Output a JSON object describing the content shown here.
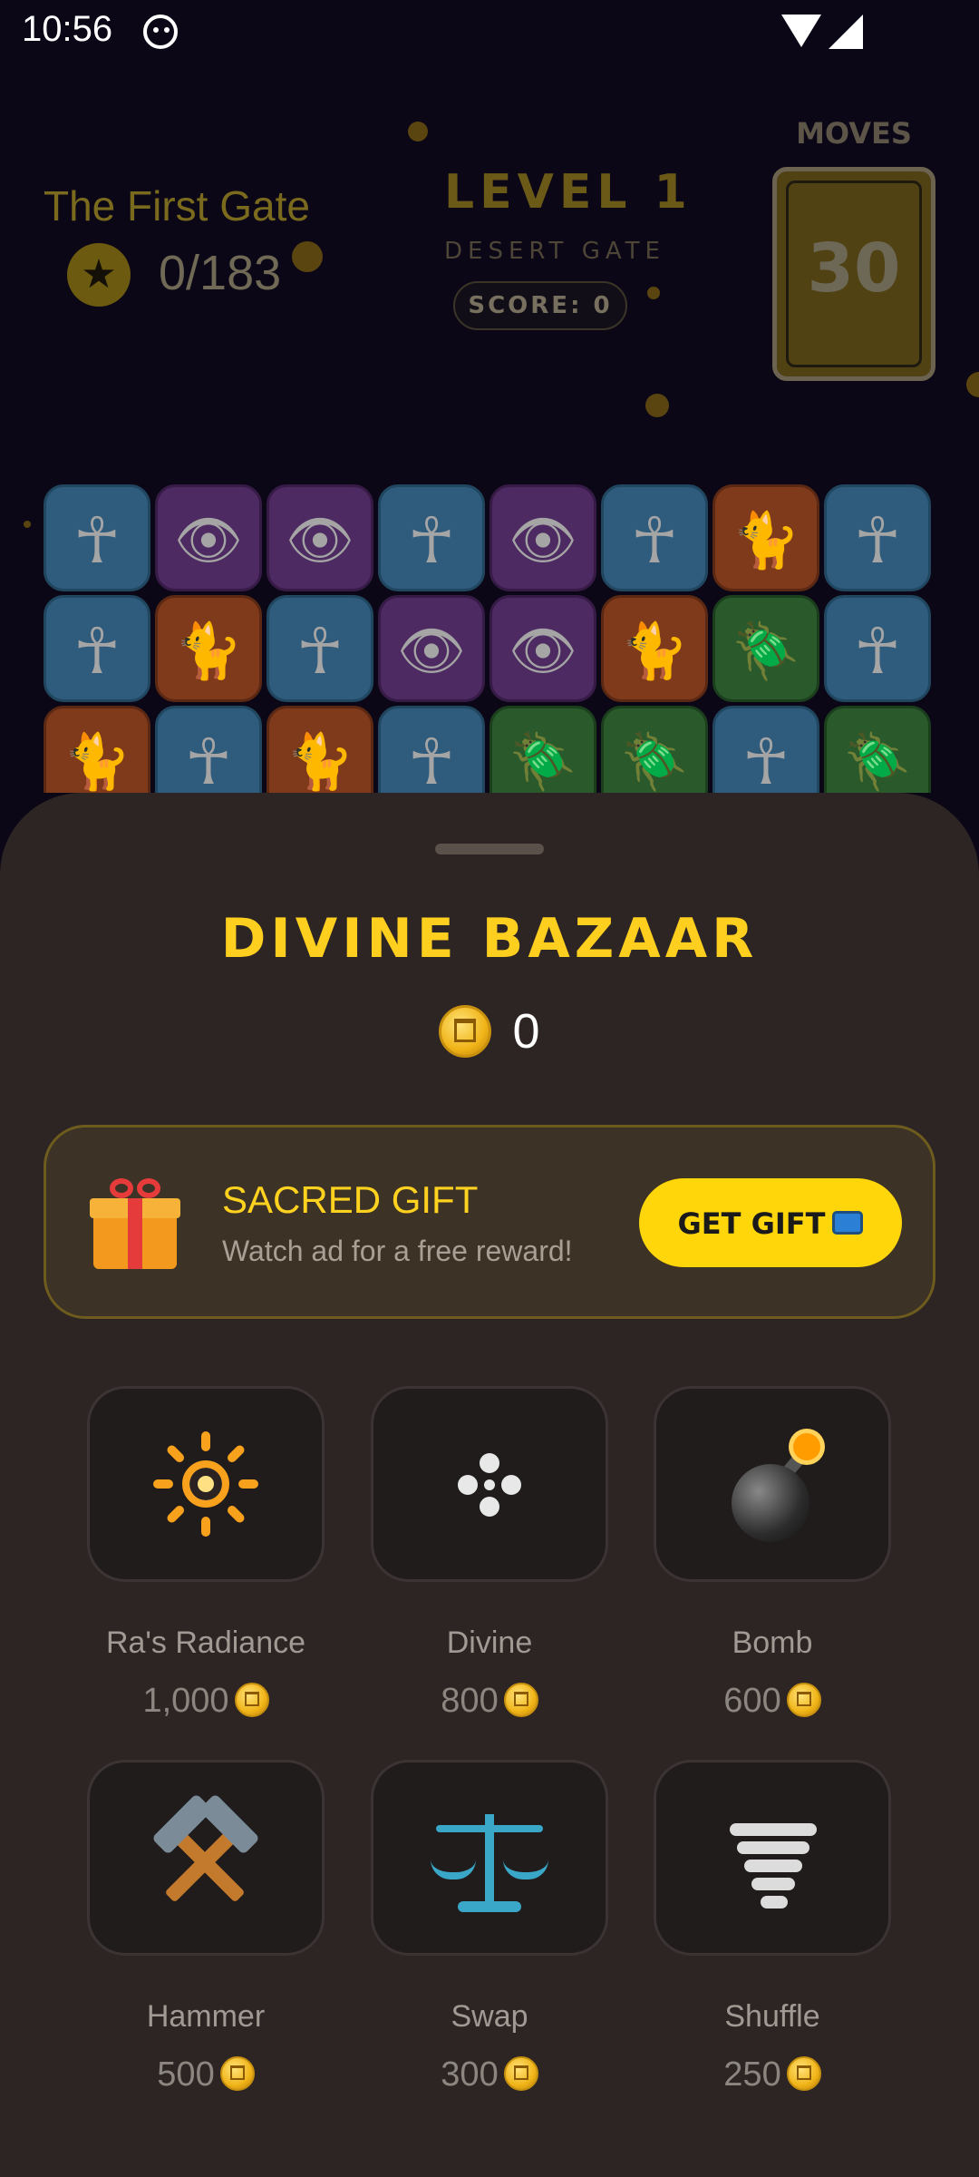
{
  "status_bar": {
    "time": "10:56"
  },
  "game": {
    "level_name": "The First Gate",
    "stars": "0/183",
    "level_title": "LEVEL 1",
    "level_subtitle": "DESERT GATE",
    "score": "SCORE: 0",
    "moves_label": "MOVES",
    "moves_value": "30",
    "board": [
      [
        "ankh",
        "eye",
        "eye",
        "ankh",
        "eye",
        "ankh",
        "cat",
        "ankh"
      ],
      [
        "ankh",
        "cat",
        "ankh",
        "eye",
        "eye",
        "cat",
        "scarab",
        "ankh"
      ],
      [
        "cat",
        "ankh",
        "cat",
        "ankh",
        "scarab",
        "scarab",
        "ankh",
        "scarab"
      ]
    ]
  },
  "bazaar": {
    "title": "DIVINE BAZAAR",
    "balance": "0",
    "gift": {
      "title": "SACRED GIFT",
      "subtitle": "Watch ad for a free reward!",
      "button": "GET GIFT"
    },
    "items": [
      {
        "name": "Ra's Radiance",
        "price": "1,000",
        "icon": "sun-icon"
      },
      {
        "name": "Divine",
        "price": "800",
        "icon": "four-point-cross-icon"
      },
      {
        "name": "Bomb",
        "price": "600",
        "icon": "bomb-icon"
      },
      {
        "name": "Hammer",
        "price": "500",
        "icon": "hammer-pick-icon"
      },
      {
        "name": "Swap",
        "price": "300",
        "icon": "balance-scale-icon"
      },
      {
        "name": "Shuffle",
        "price": "250",
        "icon": "tornado-icon"
      }
    ]
  },
  "colors": {
    "accent": "#ffcf1f",
    "button": "#ffd60a",
    "sheet": "#2c2523"
  }
}
